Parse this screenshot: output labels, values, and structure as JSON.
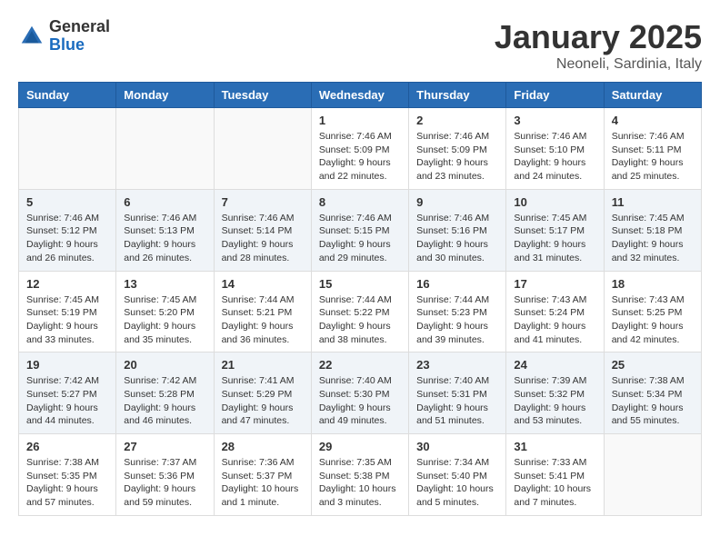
{
  "header": {
    "logo_general": "General",
    "logo_blue": "Blue",
    "month_title": "January 2025",
    "location": "Neoneli, Sardinia, Italy"
  },
  "days_of_week": [
    "Sunday",
    "Monday",
    "Tuesday",
    "Wednesday",
    "Thursday",
    "Friday",
    "Saturday"
  ],
  "weeks": [
    [
      {
        "day": "",
        "info": ""
      },
      {
        "day": "",
        "info": ""
      },
      {
        "day": "",
        "info": ""
      },
      {
        "day": "1",
        "info": "Sunrise: 7:46 AM\nSunset: 5:09 PM\nDaylight: 9 hours and 22 minutes."
      },
      {
        "day": "2",
        "info": "Sunrise: 7:46 AM\nSunset: 5:09 PM\nDaylight: 9 hours and 23 minutes."
      },
      {
        "day": "3",
        "info": "Sunrise: 7:46 AM\nSunset: 5:10 PM\nDaylight: 9 hours and 24 minutes."
      },
      {
        "day": "4",
        "info": "Sunrise: 7:46 AM\nSunset: 5:11 PM\nDaylight: 9 hours and 25 minutes."
      }
    ],
    [
      {
        "day": "5",
        "info": "Sunrise: 7:46 AM\nSunset: 5:12 PM\nDaylight: 9 hours and 26 minutes."
      },
      {
        "day": "6",
        "info": "Sunrise: 7:46 AM\nSunset: 5:13 PM\nDaylight: 9 hours and 26 minutes."
      },
      {
        "day": "7",
        "info": "Sunrise: 7:46 AM\nSunset: 5:14 PM\nDaylight: 9 hours and 28 minutes."
      },
      {
        "day": "8",
        "info": "Sunrise: 7:46 AM\nSunset: 5:15 PM\nDaylight: 9 hours and 29 minutes."
      },
      {
        "day": "9",
        "info": "Sunrise: 7:46 AM\nSunset: 5:16 PM\nDaylight: 9 hours and 30 minutes."
      },
      {
        "day": "10",
        "info": "Sunrise: 7:45 AM\nSunset: 5:17 PM\nDaylight: 9 hours and 31 minutes."
      },
      {
        "day": "11",
        "info": "Sunrise: 7:45 AM\nSunset: 5:18 PM\nDaylight: 9 hours and 32 minutes."
      }
    ],
    [
      {
        "day": "12",
        "info": "Sunrise: 7:45 AM\nSunset: 5:19 PM\nDaylight: 9 hours and 33 minutes."
      },
      {
        "day": "13",
        "info": "Sunrise: 7:45 AM\nSunset: 5:20 PM\nDaylight: 9 hours and 35 minutes."
      },
      {
        "day": "14",
        "info": "Sunrise: 7:44 AM\nSunset: 5:21 PM\nDaylight: 9 hours and 36 minutes."
      },
      {
        "day": "15",
        "info": "Sunrise: 7:44 AM\nSunset: 5:22 PM\nDaylight: 9 hours and 38 minutes."
      },
      {
        "day": "16",
        "info": "Sunrise: 7:44 AM\nSunset: 5:23 PM\nDaylight: 9 hours and 39 minutes."
      },
      {
        "day": "17",
        "info": "Sunrise: 7:43 AM\nSunset: 5:24 PM\nDaylight: 9 hours and 41 minutes."
      },
      {
        "day": "18",
        "info": "Sunrise: 7:43 AM\nSunset: 5:25 PM\nDaylight: 9 hours and 42 minutes."
      }
    ],
    [
      {
        "day": "19",
        "info": "Sunrise: 7:42 AM\nSunset: 5:27 PM\nDaylight: 9 hours and 44 minutes."
      },
      {
        "day": "20",
        "info": "Sunrise: 7:42 AM\nSunset: 5:28 PM\nDaylight: 9 hours and 46 minutes."
      },
      {
        "day": "21",
        "info": "Sunrise: 7:41 AM\nSunset: 5:29 PM\nDaylight: 9 hours and 47 minutes."
      },
      {
        "day": "22",
        "info": "Sunrise: 7:40 AM\nSunset: 5:30 PM\nDaylight: 9 hours and 49 minutes."
      },
      {
        "day": "23",
        "info": "Sunrise: 7:40 AM\nSunset: 5:31 PM\nDaylight: 9 hours and 51 minutes."
      },
      {
        "day": "24",
        "info": "Sunrise: 7:39 AM\nSunset: 5:32 PM\nDaylight: 9 hours and 53 minutes."
      },
      {
        "day": "25",
        "info": "Sunrise: 7:38 AM\nSunset: 5:34 PM\nDaylight: 9 hours and 55 minutes."
      }
    ],
    [
      {
        "day": "26",
        "info": "Sunrise: 7:38 AM\nSunset: 5:35 PM\nDaylight: 9 hours and 57 minutes."
      },
      {
        "day": "27",
        "info": "Sunrise: 7:37 AM\nSunset: 5:36 PM\nDaylight: 9 hours and 59 minutes."
      },
      {
        "day": "28",
        "info": "Sunrise: 7:36 AM\nSunset: 5:37 PM\nDaylight: 10 hours and 1 minute."
      },
      {
        "day": "29",
        "info": "Sunrise: 7:35 AM\nSunset: 5:38 PM\nDaylight: 10 hours and 3 minutes."
      },
      {
        "day": "30",
        "info": "Sunrise: 7:34 AM\nSunset: 5:40 PM\nDaylight: 10 hours and 5 minutes."
      },
      {
        "day": "31",
        "info": "Sunrise: 7:33 AM\nSunset: 5:41 PM\nDaylight: 10 hours and 7 minutes."
      },
      {
        "day": "",
        "info": ""
      }
    ]
  ]
}
